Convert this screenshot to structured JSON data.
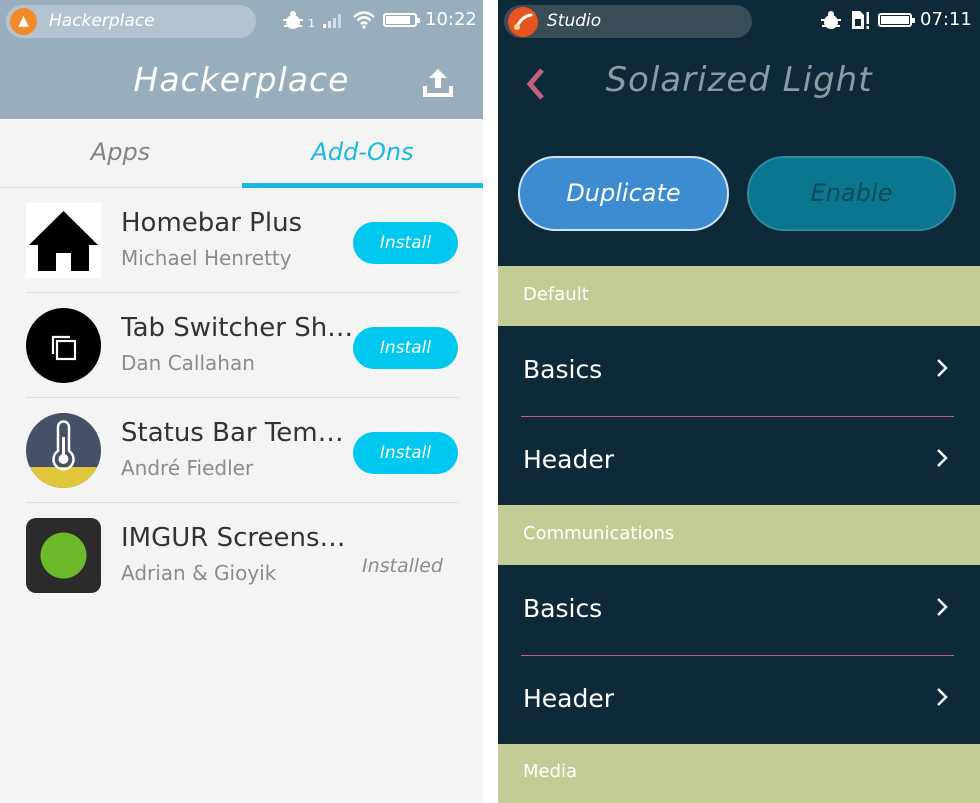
{
  "left": {
    "status": {
      "app_name": "Hackerplace",
      "time": "10:22",
      "signal_label": "1"
    },
    "header": {
      "title": "Hackerplace",
      "upload_icon": "upload-icon"
    },
    "tabs": [
      {
        "label": "Apps",
        "active": false
      },
      {
        "label": "Add-Ons",
        "active": true
      }
    ],
    "items": [
      {
        "name": "Homebar Plus",
        "author": "Michael Henretty",
        "action": "Install",
        "icon": "house-icon"
      },
      {
        "name": "Tab Switcher Sh…",
        "author": "Dan Callahan",
        "action": "Install",
        "icon": "tabs-icon"
      },
      {
        "name": "Status Bar Tem…",
        "author": "André Fiedler",
        "action": "Install",
        "icon": "thermometer-icon"
      },
      {
        "name": "IMGUR Screens…",
        "author": "Adrian & Gioyik",
        "action": "Installed",
        "icon": "green-dot-icon"
      }
    ],
    "colors": {
      "accent": "#1ab8e0",
      "header_bg": "#98aebd",
      "button": "#00c8ef"
    }
  },
  "right": {
    "status": {
      "app_name": "Studio",
      "time": "07:11"
    },
    "header": {
      "title": "Solarized Light",
      "back_icon": "chevron-left-icon"
    },
    "buttons": {
      "duplicate": "Duplicate",
      "enable": "Enable"
    },
    "sections": [
      {
        "title": "Default",
        "items": [
          "Basics",
          "Header"
        ]
      },
      {
        "title": "Communications",
        "items": [
          "Basics",
          "Header"
        ]
      },
      {
        "title": "Media",
        "items": []
      }
    ],
    "colors": {
      "bg": "#0e2a38",
      "section_bg": "#c3cc95",
      "divider": "#c2607f",
      "duplicate": "#3d8bd1",
      "enable": "#0a7690"
    }
  }
}
